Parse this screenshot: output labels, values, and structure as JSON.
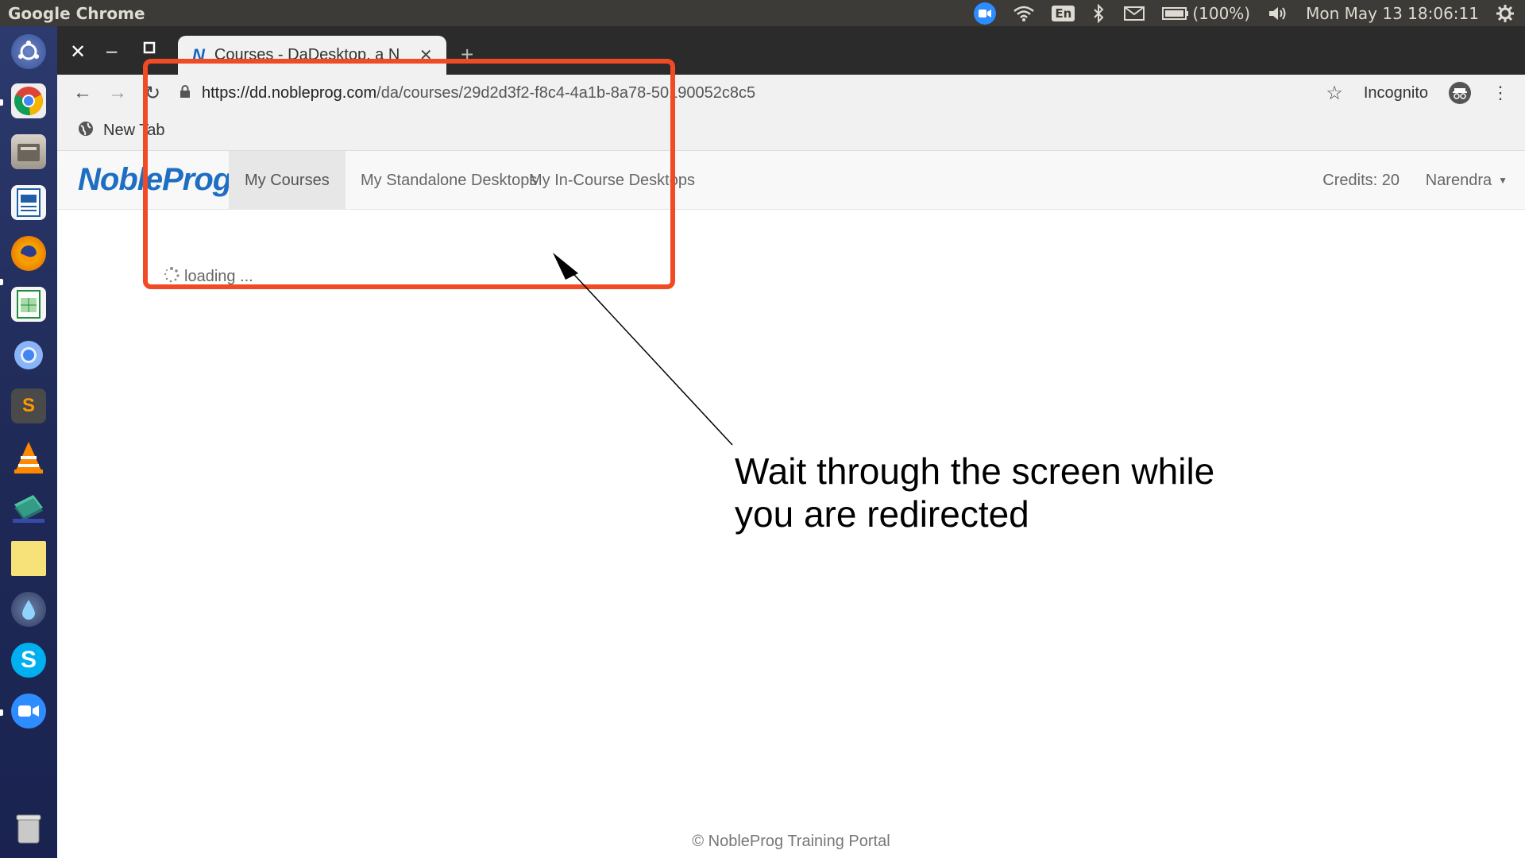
{
  "topbar": {
    "app_name": "Google Chrome",
    "keyboard_layout": "En",
    "battery": "(100%)",
    "datetime": "Mon May 13 18:06:11"
  },
  "launcher": {
    "apps": [
      "ubuntu-dash",
      "chrome",
      "files",
      "writer",
      "firefox",
      "calc",
      "chromium",
      "sublime-text",
      "vlc",
      "pdf-tool",
      "notes",
      "drops",
      "skype",
      "zoom",
      "trash"
    ]
  },
  "browser": {
    "tab_title": "Courses - DaDesktop, a N",
    "url_host": "https://dd.nobleprog.com",
    "url_path": "/da/courses/29d2d3f2-f8c4-4a1b-8a78-50190052c8c5",
    "incognito_label": "Incognito",
    "bookmark_label": "New Tab"
  },
  "page": {
    "brand": "NobleProg",
    "nav": [
      "My Courses",
      "My Standalone Desktops",
      "My In-Course Desktops"
    ],
    "credits": "Credits: 20",
    "user": "Narendra",
    "loading_text": "loading ...",
    "footer": "© NobleProg Training Portal"
  },
  "annotation": {
    "text_line1": "Wait through the screen while",
    "text_line2": "you are redirected",
    "box_color": "#f04b24"
  },
  "colors": {
    "brand": "#1e6fc2",
    "topbar": "#3c3b37",
    "tabstrip": "#2b2b2b"
  }
}
